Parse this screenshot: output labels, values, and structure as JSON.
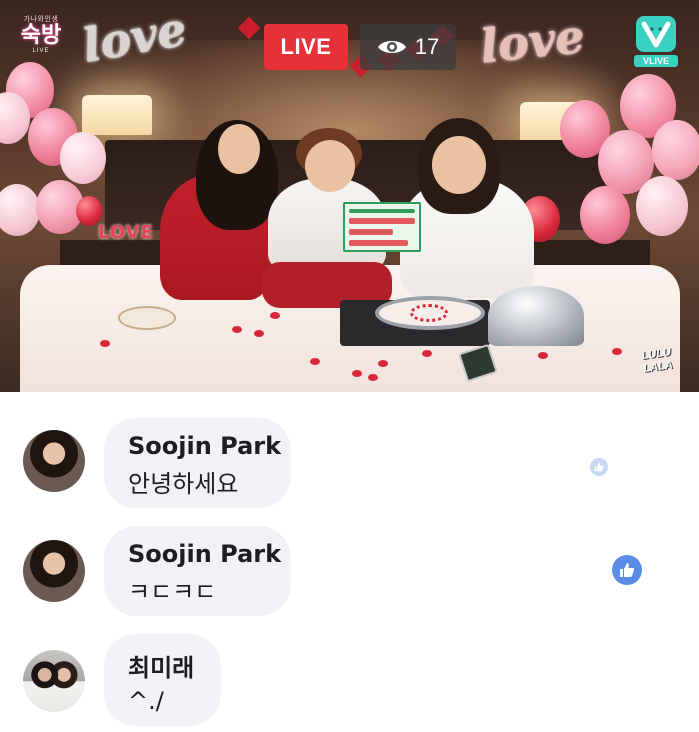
{
  "stream": {
    "live_label": "LIVE",
    "viewer_count": "17",
    "viewer_icon": "eye-icon",
    "channel_logo": {
      "small": "가나와인생",
      "big": "숙방",
      "tag": "LIVE"
    },
    "platform_logo": {
      "icon": "vlive-v-icon",
      "word": "VLIVE"
    },
    "watermark": "LULU LALA",
    "colors": {
      "live_red": "#e8323a",
      "viewer_bg": "#3c3c3c",
      "vlive_teal": "#3ad1c2"
    }
  },
  "comments": [
    {
      "author": "Soojin Park",
      "message": "안녕하세요",
      "avatar": "avatar-woman-dark-hair",
      "liked": "faded-like-icon"
    },
    {
      "author": "Soojin Park",
      "message": "ㅋㄷㅋㄷ",
      "avatar": "avatar-woman-dark-hair",
      "liked": "like-icon"
    },
    {
      "author": "최미래",
      "message": "^./",
      "avatar": "avatar-couple-wedding",
      "liked": ""
    }
  ],
  "ui_colors": {
    "bubble_bg": "#f0f2f5",
    "like_blue": "#5b8de8",
    "text": "#1c1e21"
  }
}
